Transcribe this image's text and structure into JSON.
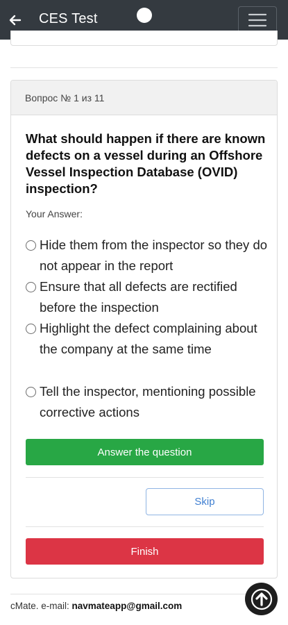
{
  "appbar": {
    "title": "CES Test",
    "back_icon": "arrow-left-icon",
    "menu_icon": "hamburger-menu-icon",
    "background": "#343a40"
  },
  "quiz": {
    "progress_label": "Вопрос № 1 из 11",
    "question": "What should happen if there are known defects on a vessel during an Offshore Vessel Inspection Database (OVID) inspection?",
    "answer_label": "Your Answer:",
    "options": [
      {
        "label": "Hide them from the inspector so they do not appear in the report",
        "selected": false
      },
      {
        "label": "Ensure that all defects are rectified before the inspection",
        "selected": false
      },
      {
        "label": "Highlight the defect complaining about the company at the same time",
        "selected": false
      },
      {
        "label": "Tell the inspector, mentioning possible corrective actions",
        "selected": false
      }
    ]
  },
  "actions": {
    "answer_label": "Answer the question",
    "skip_label": "Skip",
    "finish_label": "Finish",
    "colors": {
      "answer": "#28a745",
      "skip": "#3f7fd1",
      "finish": "#dc3545"
    }
  },
  "footer": {
    "prefix": "cMate. e-mail: ",
    "email": "navmateapp@gmail.com",
    "scroll_top_icon": "arrow-up-icon"
  }
}
